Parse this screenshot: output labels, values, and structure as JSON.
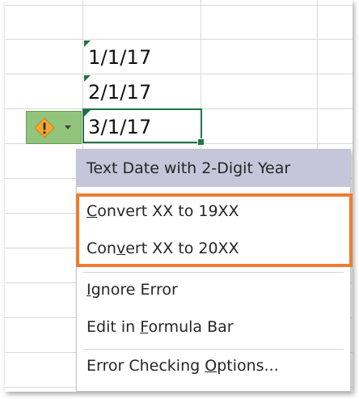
{
  "cells": [
    {
      "value": "1/1/17"
    },
    {
      "value": "2/1/17"
    },
    {
      "value": "3/1/17"
    }
  ],
  "smart_tag": {
    "icon": "warning-icon",
    "dropdown_icon": "chevron-down-icon",
    "color": "#93c47d",
    "icon_color": "#f0a830"
  },
  "menu": {
    "header": "Text Date with 2-Digit Year",
    "items": [
      {
        "label": "Convert XX to 19XX",
        "underlined": "C"
      },
      {
        "label": "Convert XX to 20XX",
        "underlined": "v"
      },
      {
        "label": "Ignore Error",
        "underlined": "I"
      },
      {
        "label": "Edit in Formula Bar",
        "underlined": "F"
      },
      {
        "label": "Error Checking Options...",
        "underlined": "O"
      }
    ]
  },
  "colors": {
    "highlight_border": "#ed7d31",
    "header_bg": "#c5c6d9",
    "selection": "#217346",
    "error_triangle": "#1e7145"
  }
}
